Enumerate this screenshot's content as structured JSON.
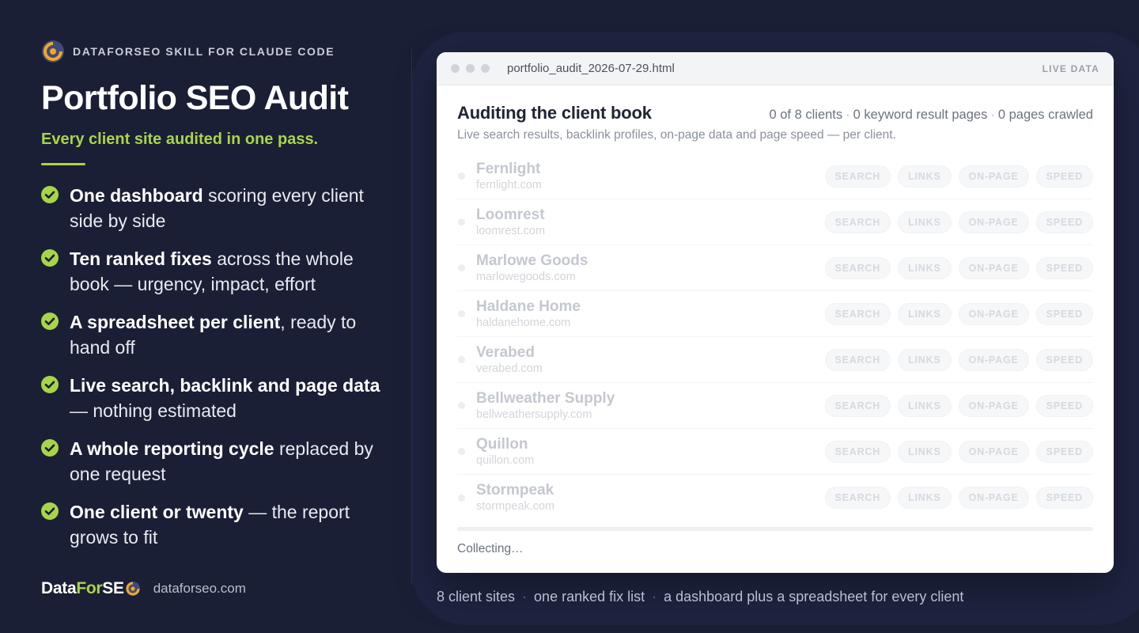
{
  "eyebrow": "DATAFORSEO SKILL FOR CLAUDE CODE",
  "title": "Portfolio SEO Audit",
  "subtitle": "Every client site audited in one pass.",
  "features": [
    {
      "bold": "One dashboard",
      "rest": " scoring every client side by side"
    },
    {
      "bold": "Ten ranked fixes",
      "rest": " across the whole book — urgency, impact, effort"
    },
    {
      "bold": "A spreadsheet per client",
      "rest": ", ready to hand off"
    },
    {
      "bold": "Live search, backlink and page data",
      "rest": " — nothing estimated"
    },
    {
      "bold": "A whole reporting cycle",
      "rest": " replaced by one request"
    },
    {
      "bold": "One client or twenty",
      "rest": " — the report grows to fit"
    }
  ],
  "brand": {
    "wordmark_data": "Data",
    "wordmark_for": "For",
    "wordmark_se": "SE",
    "url": "dataforseo.com",
    "accent": "#a8d548",
    "logo_orange": "#f5a623",
    "logo_blue": "#3d4b7a"
  },
  "window": {
    "filename": "portfolio_audit_2026-07-29.html",
    "badge": "LIVE DATA",
    "heading": "Auditing the client book",
    "stats": [
      "0 of 8 clients",
      "0 keyword result pages",
      "0 pages crawled"
    ],
    "stats_separator": "·",
    "description": "Live search results, backlink profiles, on-page data and page speed — per client.",
    "chips": [
      "SEARCH",
      "LINKS",
      "ON-PAGE",
      "SPEED"
    ],
    "clients": [
      {
        "name": "Fernlight",
        "domain": "fernlight.com"
      },
      {
        "name": "Loomrest",
        "domain": "loomrest.com"
      },
      {
        "name": "Marlowe Goods",
        "domain": "marlowegoods.com"
      },
      {
        "name": "Haldane Home",
        "domain": "haldanehome.com"
      },
      {
        "name": "Verabed",
        "domain": "verabed.com"
      },
      {
        "name": "Bellweather Supply",
        "domain": "bellweathersupply.com"
      },
      {
        "name": "Quillon",
        "domain": "quillon.com"
      },
      {
        "name": "Stormpeak",
        "domain": "stormpeak.com"
      }
    ],
    "progress": 0,
    "status": "Collecting…"
  },
  "caption": [
    "8 client sites",
    "one ranked fix list",
    "a dashboard plus a spreadsheet for every client"
  ],
  "caption_separator": "·"
}
